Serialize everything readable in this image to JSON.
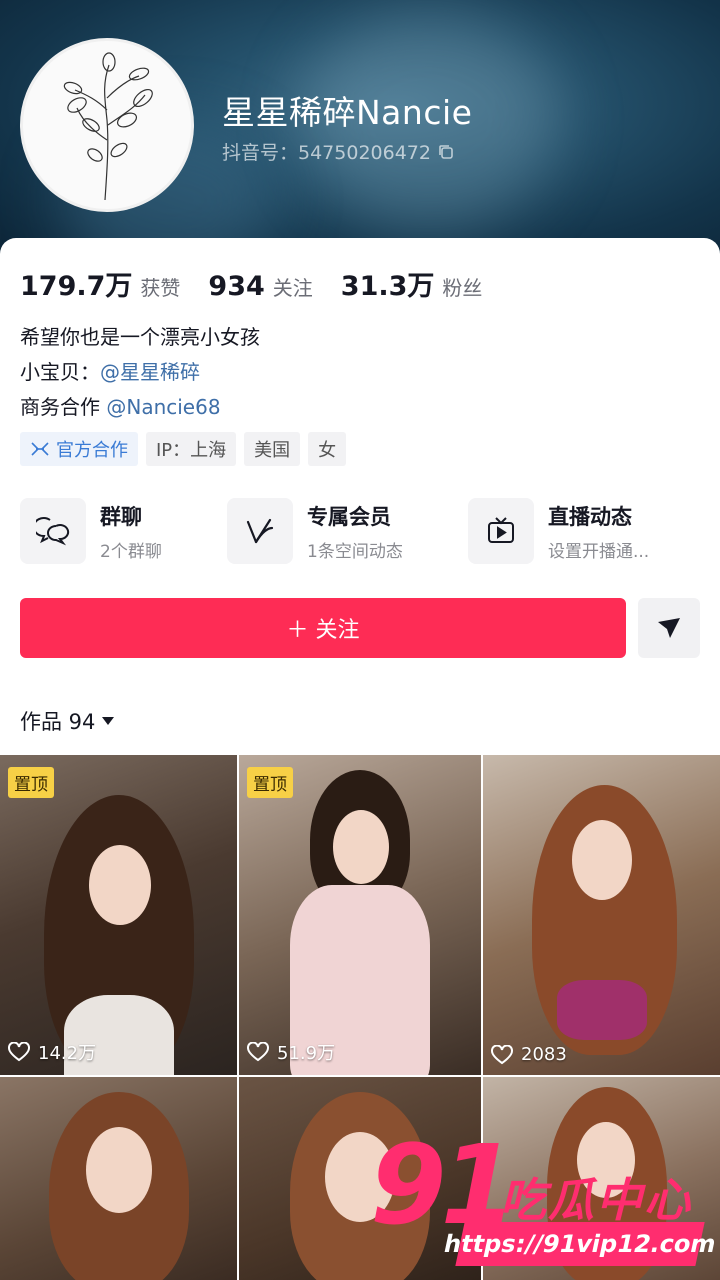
{
  "profile": {
    "nickname": "星星稀碎Nancie",
    "douyin_id": "抖音号：54750206472"
  },
  "stats": [
    {
      "value": "179.7万",
      "label": "获赞"
    },
    {
      "value": "934",
      "label": "关注"
    },
    {
      "value": "31.3万",
      "label": "粉丝"
    }
  ],
  "bio": {
    "line1": "希望你也是一个漂亮小女孩",
    "line2_prefix": "小宝贝：",
    "line2_mention": "@星星稀碎",
    "line3_prefix": "商务合作 ",
    "line3_mention": "@Nancie68"
  },
  "tags": {
    "official": "官方合作",
    "ip": "IP：上海",
    "country": "美国",
    "gender": "女"
  },
  "quick_actions": [
    {
      "title": "群聊",
      "subtitle": "2个群聊",
      "icon": "group-chat-icon"
    },
    {
      "title": "专属会员",
      "subtitle": "1条空间动态",
      "icon": "vip-icon"
    },
    {
      "title": "直播动态",
      "subtitle": "设置开播通...",
      "icon": "live-tv-icon"
    }
  ],
  "follow_button": "＋ 关注",
  "works_tab": "作品 94",
  "videos": [
    {
      "pinned": "置顶",
      "likes": "14.2万"
    },
    {
      "pinned": "置顶",
      "likes": "51.9万"
    },
    {
      "pinned": "",
      "likes": "2083"
    },
    {
      "pinned": "",
      "likes": ""
    },
    {
      "pinned": "",
      "likes": ""
    },
    {
      "pinned": "",
      "likes": ""
    }
  ],
  "watermark": {
    "number": "91",
    "text": "吃瓜中心",
    "url": "https://91vip12.com"
  },
  "colors": {
    "accent": "#fe2c55",
    "mention": "#3f6fa8",
    "pin_badge": "#f7d046"
  }
}
